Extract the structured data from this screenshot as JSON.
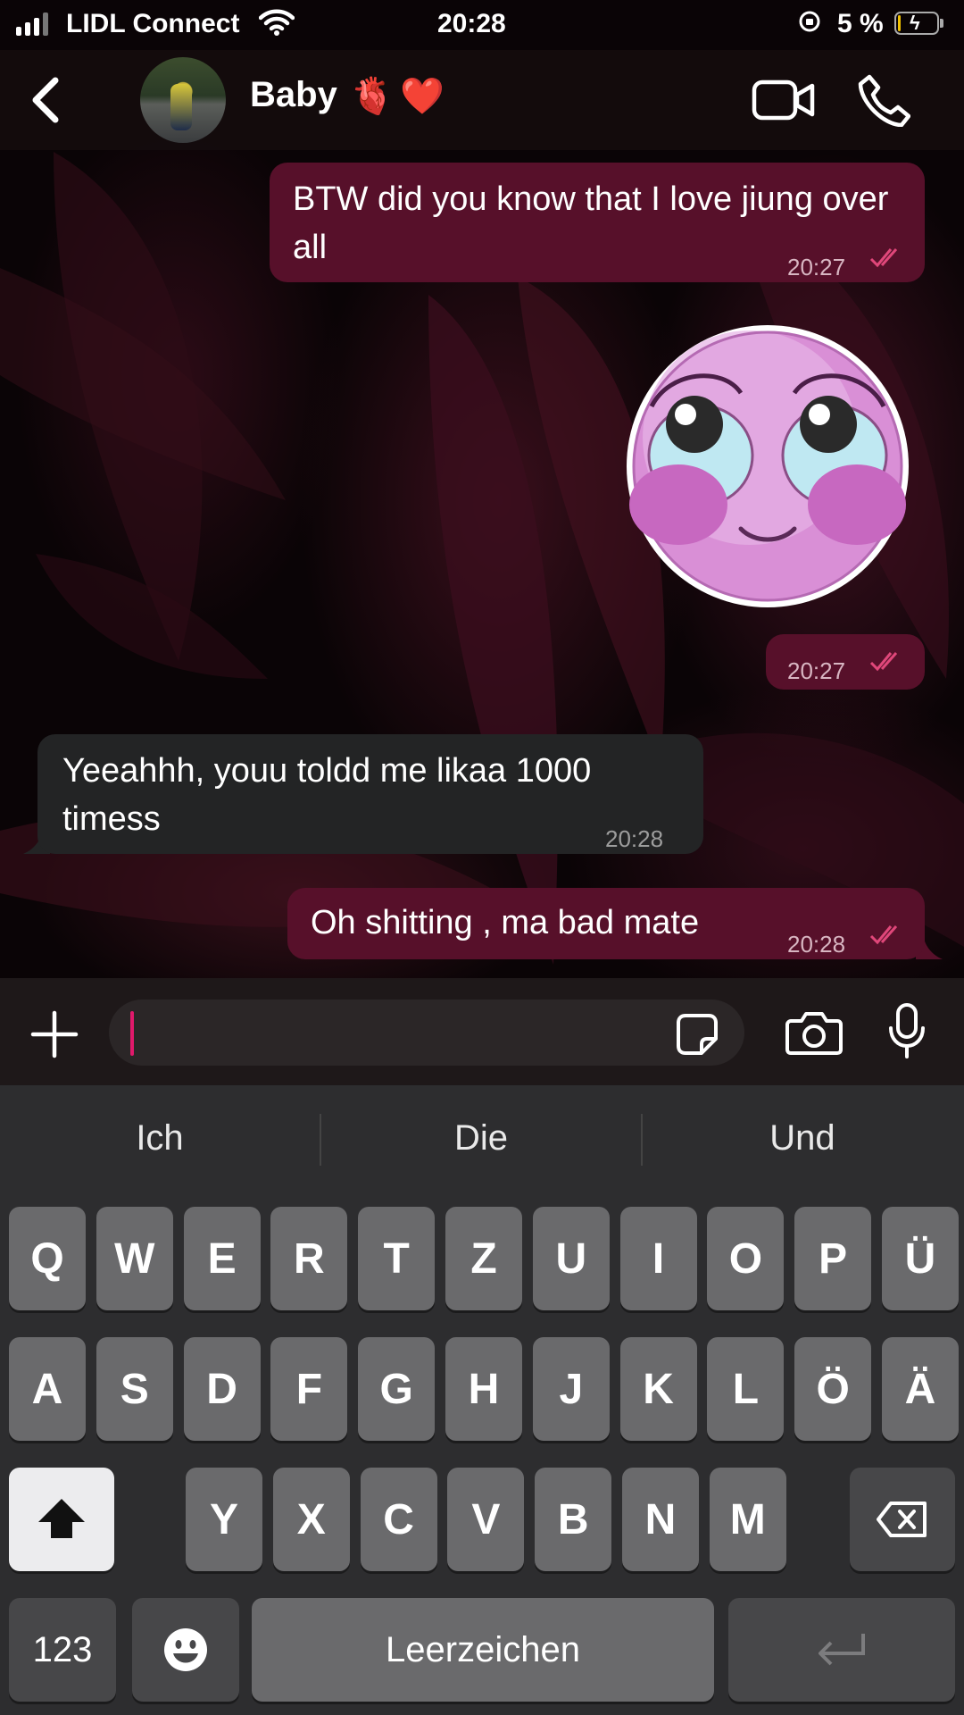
{
  "status_bar": {
    "carrier": "LIDL Connect",
    "time": "20:28",
    "battery_percent": "5 %",
    "battery_level": 0.05,
    "icons": [
      "signal-icon",
      "wifi-icon",
      "orientation-lock-icon",
      "battery-charging-icon"
    ]
  },
  "header": {
    "contact_name": "Baby",
    "name_emojis": [
      "🫀",
      "❤️"
    ],
    "icons": [
      "back-arrow-icon",
      "video-camera-icon",
      "phone-icon"
    ]
  },
  "messages": [
    {
      "direction": "outgoing",
      "text": "BTW did you know that I love jiung over all",
      "time": "20:27",
      "status": "read"
    },
    {
      "direction": "outgoing",
      "type": "sticker",
      "sticker": "pink-smiley-face-sticker",
      "time": "20:27",
      "status": "read"
    },
    {
      "direction": "incoming",
      "text": "Yeeahhh, youu toldd me likaa 1000 timess",
      "time": "20:28"
    },
    {
      "direction": "outgoing",
      "text": "Oh shitting , ma bad mate",
      "time": "20:28",
      "status": "read"
    }
  ],
  "input_bar": {
    "value": "",
    "icons": [
      "plus-icon",
      "sticker-icon",
      "camera-icon",
      "microphone-icon"
    ]
  },
  "keyboard": {
    "suggestions": [
      "Ich",
      "Die",
      "Und"
    ],
    "rows": [
      [
        "Q",
        "W",
        "E",
        "R",
        "T",
        "Z",
        "U",
        "I",
        "O",
        "P",
        "Ü"
      ],
      [
        "A",
        "S",
        "D",
        "F",
        "G",
        "H",
        "J",
        "K",
        "L",
        "Ö",
        "Ä"
      ],
      [
        "Y",
        "X",
        "C",
        "V",
        "B",
        "N",
        "M"
      ]
    ],
    "numbers_key": "123",
    "space_key": "Leerzeichen",
    "icons": [
      "shift-icon",
      "backspace-icon",
      "emoji-icon",
      "return-icon"
    ]
  },
  "colors": {
    "outgoing_bubble": "#57102a",
    "incoming_bubble": "#232425",
    "caret": "#e0196b",
    "read_ticks": "#e0477a"
  }
}
